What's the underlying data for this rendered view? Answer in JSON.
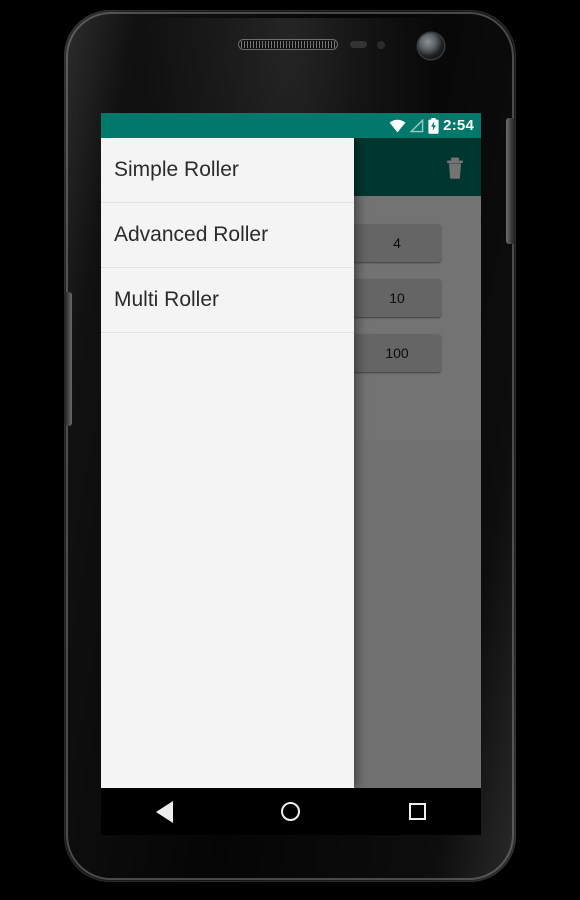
{
  "device": {
    "hardware": {
      "earpiece": "earpiece-speaker",
      "proximity_sensor": "proximity-sensor",
      "light_sensor": "ambient-light-sensor",
      "front_camera": "front-camera",
      "power_button": "power-button",
      "volume_button": "volume-button"
    }
  },
  "status_bar": {
    "clock": "2:54",
    "icons": [
      "wifi-icon",
      "signal-icon",
      "battery-charging-icon"
    ],
    "background": "#00796B"
  },
  "app": {
    "toolbar": {
      "title": "",
      "background": "#00796B",
      "actions": [
        {
          "name": "delete-button",
          "icon": "trash-icon"
        }
      ]
    },
    "rows": [
      {
        "label": "",
        "button": "4"
      },
      {
        "label": "",
        "button": "10"
      },
      {
        "label": "",
        "button": "100"
      }
    ]
  },
  "drawer": {
    "open": true,
    "background": "#f4f4f4",
    "items": [
      {
        "label": "Simple Roller"
      },
      {
        "label": "Advanced Roller"
      },
      {
        "label": "Multi Roller"
      }
    ]
  },
  "nav_bar": {
    "keys": [
      {
        "name": "nav-back-button",
        "icon": "back-triangle-icon"
      },
      {
        "name": "nav-home-button",
        "icon": "home-circle-icon"
      },
      {
        "name": "nav-recents-button",
        "icon": "recents-square-icon"
      }
    ]
  }
}
